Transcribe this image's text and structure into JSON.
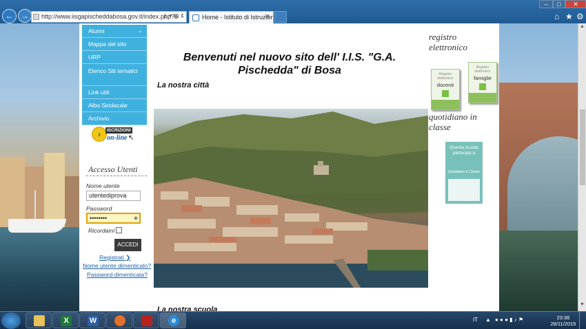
{
  "browser": {
    "url": "http://www.iisgapischeddabosa.gov.it/index.php?o",
    "address_tools": "ρ ▾ ⊞ ¢",
    "tab_title": "Home - Istituto di Istruzion...",
    "tab_close": "✕",
    "back": "←",
    "forward": "→",
    "minimize": "–",
    "maximize": "□",
    "close": "✕",
    "home_icon": "⌂",
    "favorites_icon": "★",
    "tools_icon": "⚙"
  },
  "menu": {
    "items": [
      {
        "label": "Alunni",
        "chevron": "⌄"
      },
      {
        "label": "Mappa del sito"
      },
      {
        "label": "URP"
      },
      {
        "label": "Elenco Siti tematici"
      },
      {
        "label": "Link utili"
      },
      {
        "label": "Albo Sindacale"
      },
      {
        "label": "Archivio"
      }
    ]
  },
  "iscrizioni": {
    "line1": "ISCRIZIONI",
    "line2": "on-line"
  },
  "login": {
    "title": "Accesso Utenti",
    "username_label": "Nome utente",
    "username_value": "utentediprova",
    "password_label": "Password",
    "password_value": "••••••••",
    "remember_label": "Ricordami",
    "submit_label": "ACCEDI",
    "register_link": "Registrati",
    "register_arrow": "❯",
    "forgot_username": "Nome utente dimenticato?",
    "forgot_password": "Password dimenticata?"
  },
  "main": {
    "welcome_line1": "Benvenuti nel nuovo sito dell' I.I.S. \"G.A.",
    "welcome_line2": "Pischedda\" di Bosa",
    "section_city": "La nostra città",
    "section_school": "La nostra scuola"
  },
  "right": {
    "registro_line1": "registro",
    "registro_line2": "elettronico",
    "book_docenti_lab": "Registro elettronico",
    "book_docenti": "docenti",
    "book_famiglie_lab": "Registro elettronico",
    "book_famiglie": "famiglie",
    "quotidiano_line1": "quotidiano in",
    "quotidiano_line2": "classe",
    "quot_box_text": "Questa scuola partecipa a",
    "quot_box_logo": "Quotidiano in Classe"
  },
  "taskbar": {
    "lang": "IT",
    "time": "23:36",
    "date": "28/11/2015"
  }
}
